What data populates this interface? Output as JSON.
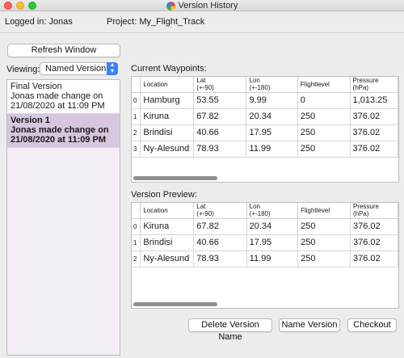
{
  "window": {
    "title": "Version History"
  },
  "header": {
    "logged_in": "Logged in: Jonas",
    "project": "Project: My_Flight_Track"
  },
  "toolbar": {
    "refresh_label": "Refresh Window"
  },
  "viewing": {
    "label": "Viewing:",
    "selected": "Named Versions"
  },
  "versions": [
    {
      "line1": "Final Version",
      "line2": "Jonas made change on",
      "line3": "21/08/2020 at 11:09 PM",
      "selected": false
    },
    {
      "line1": "Version 1",
      "line2": "Jonas made change on",
      "line3": "21/08/2020 at 11:09 PM",
      "selected": true
    }
  ],
  "current": {
    "title": "Current Waypoints:",
    "columns": [
      "Location",
      "Lat\n(+-90)",
      "Lon\n(+-180)",
      "Flightlevel",
      "Pressure\n(hPa)"
    ],
    "rows": [
      [
        "0",
        "Hamburg",
        "53.55",
        "9.99",
        "0",
        "1,013.25"
      ],
      [
        "1",
        "Kiruna",
        "67.82",
        "20.34",
        "250",
        "376.02"
      ],
      [
        "2",
        "Brindisi",
        "40.66",
        "17.95",
        "250",
        "376.02"
      ],
      [
        "3",
        "Ny-Alesund",
        "78.93",
        "11.99",
        "250",
        "376.02"
      ]
    ]
  },
  "preview": {
    "title": "Version Preview:",
    "columns": [
      "Location",
      "Lat\n(+-90)",
      "Lon\n(+-180)",
      "Flightlevel",
      "Pressure\n(hPa)"
    ],
    "rows": [
      [
        "0",
        "Kiruna",
        "67.82",
        "20.34",
        "250",
        "376.02"
      ],
      [
        "1",
        "Brindisi",
        "40.66",
        "17.95",
        "250",
        "376.02"
      ],
      [
        "2",
        "Ny-Alesund",
        "78.93",
        "11.99",
        "250",
        "376.02"
      ]
    ]
  },
  "actions": {
    "delete_name": "Delete Version Name",
    "name_version": "Name Version",
    "checkout": "Checkout"
  }
}
